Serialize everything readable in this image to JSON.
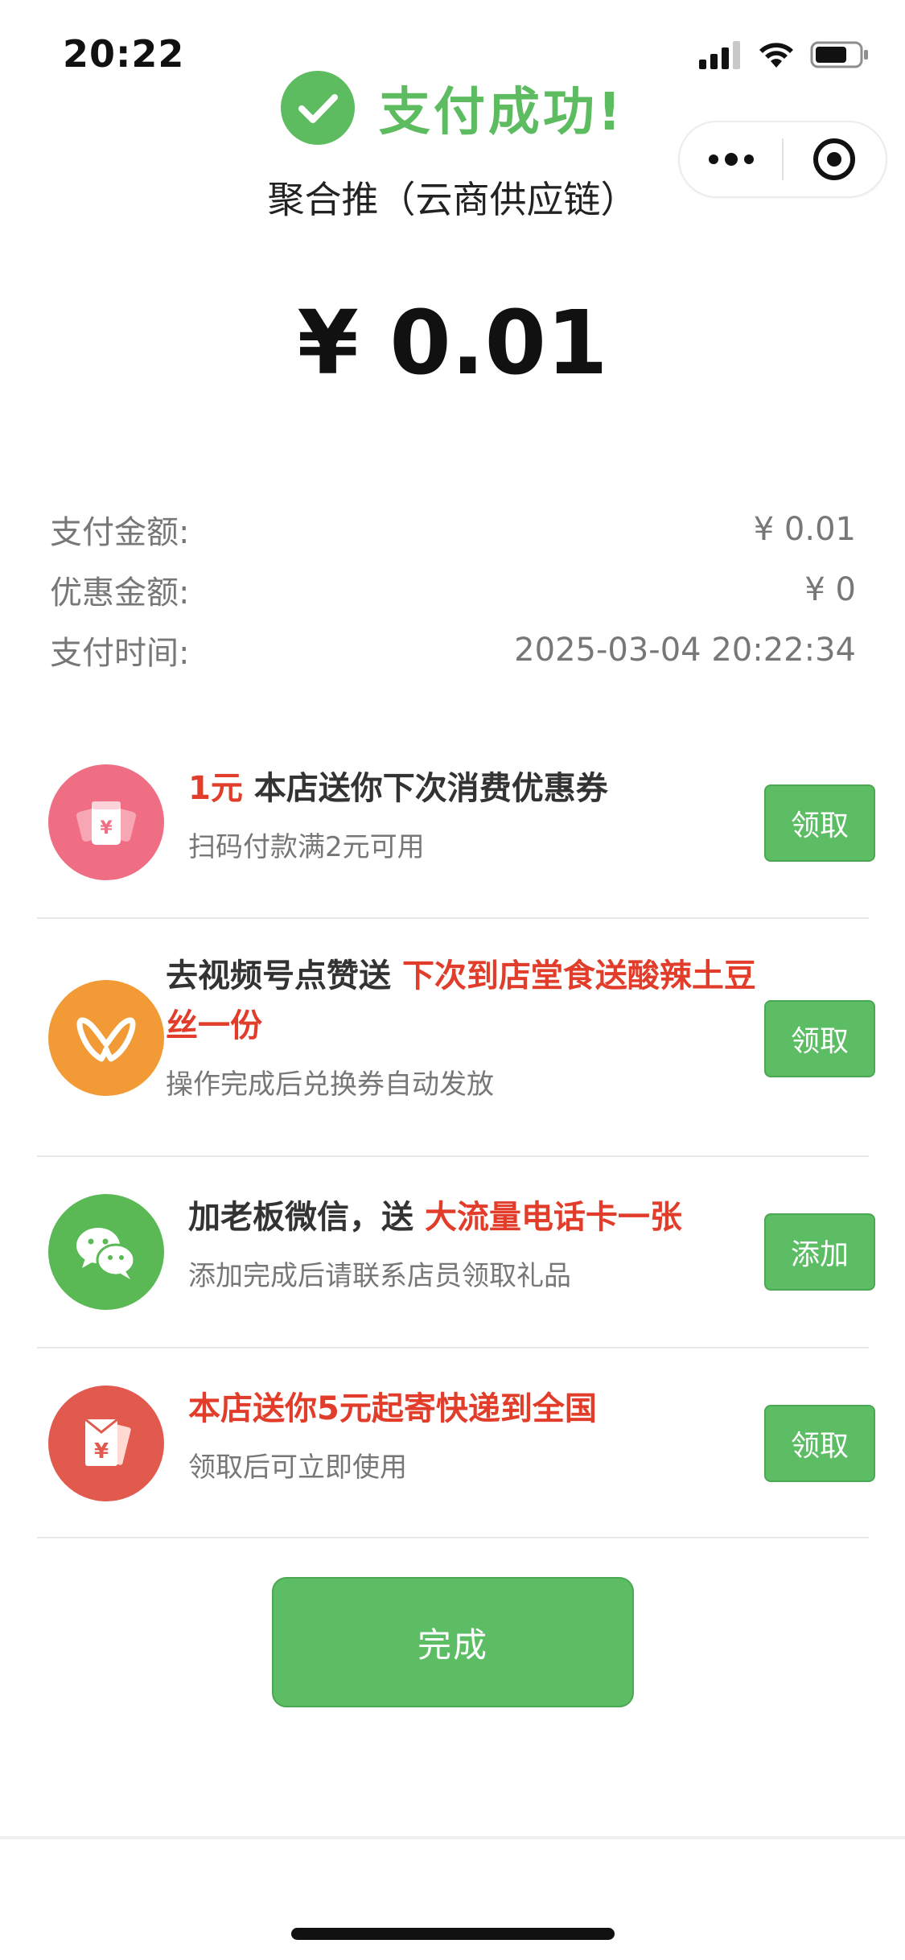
{
  "status_bar": {
    "time": "20:22"
  },
  "header": {
    "success_text": "支付成功!",
    "merchant": "聚合推（云商供应链）",
    "amount": "¥ 0.01"
  },
  "details": [
    {
      "label": "支付金额:",
      "value": "¥ 0.01"
    },
    {
      "label": "优惠金额:",
      "value": "¥ 0"
    },
    {
      "label": "支付时间:",
      "value": "2025-03-04 20:22:34"
    }
  ],
  "offers": [
    {
      "icon": "coupon-ticket-icon",
      "title_red": "1元",
      "title_dark": " 本店送你下次消费优惠券",
      "subtitle": "扫码付款满2元可用",
      "button": "领取"
    },
    {
      "icon": "channels-icon",
      "title_dark": "去视频号点赞送 ",
      "title_red": "下次到店堂食送酸辣土豆丝一份",
      "subtitle": "操作完成后兑换券自动发放",
      "button": "领取"
    },
    {
      "icon": "wechat-icon",
      "title_dark": "加老板微信，送 ",
      "title_red": "大流量电话卡一张",
      "subtitle": "添加完成后请联系店员领取礼品",
      "button": "添加"
    },
    {
      "icon": "red-envelope-icon",
      "title_red": "本店送你5元起寄快递到全国",
      "subtitle": "领取后可立即使用",
      "button": "领取"
    }
  ],
  "done_button": "完成",
  "colors": {
    "accent_green": "#5cbd64",
    "highlight_red": "#e23c2a",
    "wechat_green": "#5ab955",
    "coupon_pink": "#ef6e84",
    "channels_orange": "#f29b36",
    "envelope_red": "#e25a4e"
  }
}
